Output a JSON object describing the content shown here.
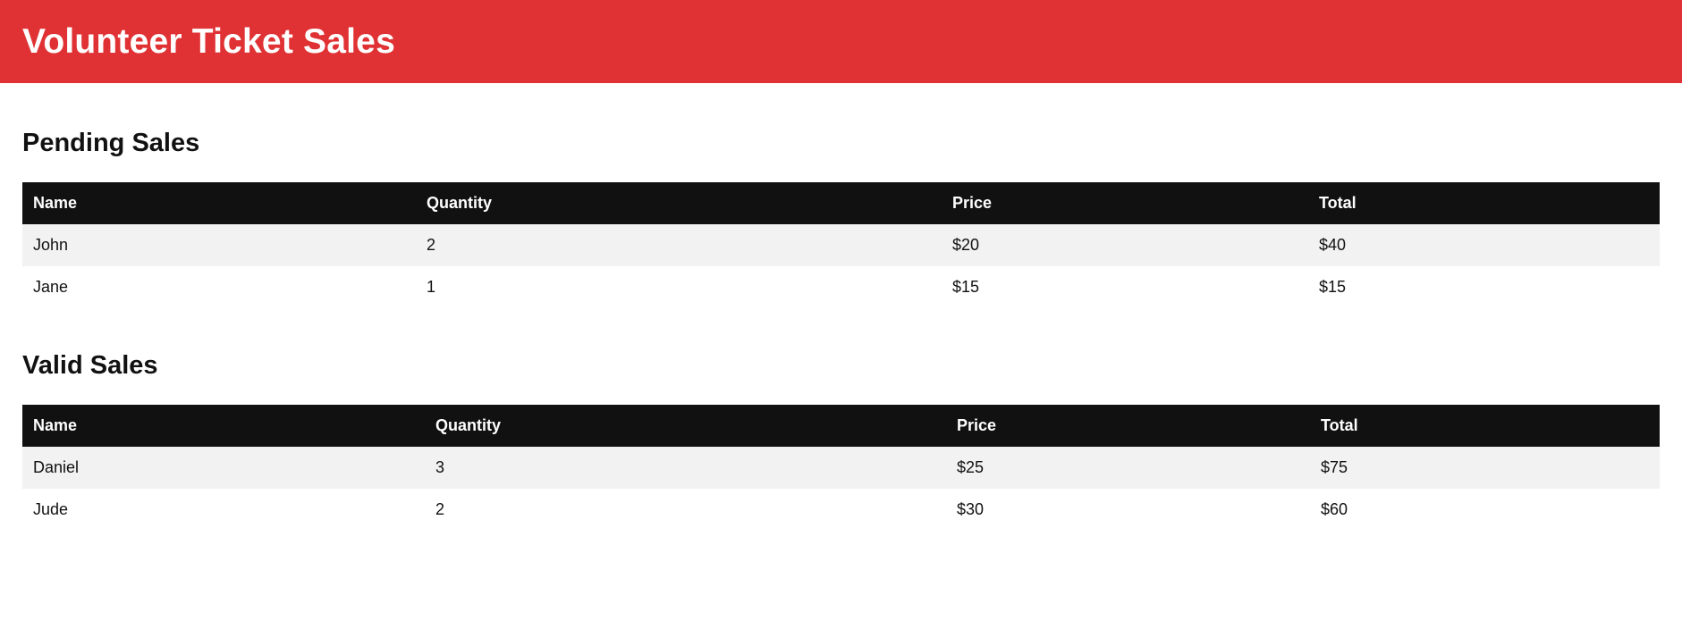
{
  "header": {
    "title": "Volunteer Ticket Sales"
  },
  "pending": {
    "title": "Pending Sales",
    "columns": [
      "Name",
      "Quantity",
      "Price",
      "Total"
    ],
    "rows": [
      [
        "John",
        "2",
        "$20",
        "$40"
      ],
      [
        "Jane",
        "1",
        "$15",
        "$15"
      ]
    ]
  },
  "valid": {
    "title": "Valid Sales",
    "columns": [
      "Name",
      "Quantity",
      "Price",
      "Total"
    ],
    "rows": [
      [
        "Daniel",
        "3",
        "$25",
        "$75"
      ],
      [
        "Jude",
        "2",
        "$30",
        "$60"
      ]
    ]
  },
  "colors": {
    "header_bg": "#e03234",
    "table_header_bg": "#111111",
    "row_alt_bg": "#f2f2f2"
  }
}
